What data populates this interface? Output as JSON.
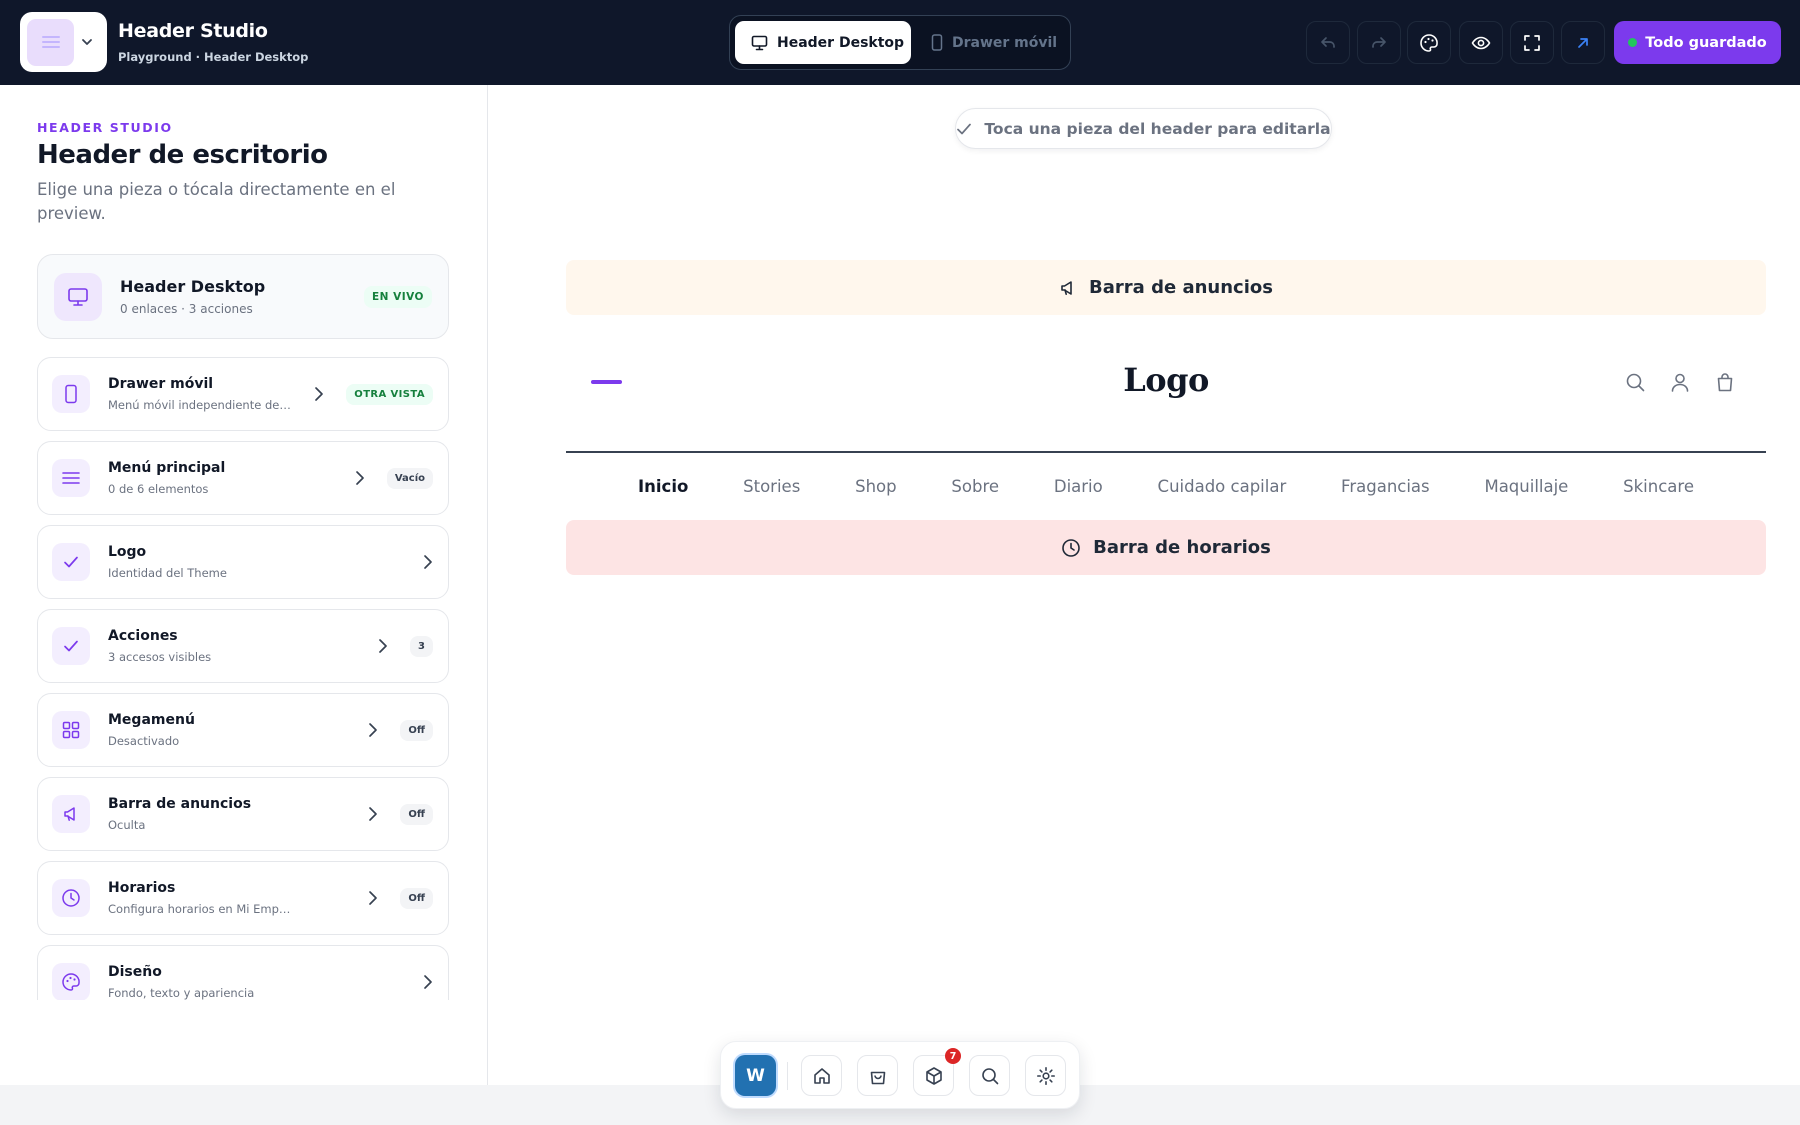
{
  "app": {
    "title": "Header Studio",
    "subtitle": "Playground · Header Desktop"
  },
  "view_toggle": {
    "desktop_label": "Header Desktop",
    "mobile_label": "Drawer móvil"
  },
  "toolbar": {
    "save_label": "Todo guardado"
  },
  "sidebar": {
    "eyebrow": "HEADER STUDIO",
    "title": "Header de escritorio",
    "description": "Elige una pieza o tócala directamente en el preview.",
    "hero": {
      "title": "Header Desktop",
      "subtitle": "0 enlaces · 3 acciones",
      "badge": "EN VIVO"
    },
    "items": [
      {
        "title": "Drawer móvil",
        "subtitle": "Menú móvil independiente del header de escritorio",
        "badge": "OTRA VISTA",
        "icon": "smartphone-icon"
      },
      {
        "title": "Menú principal",
        "subtitle": "0 de 6 elementos",
        "badge": "Vacío",
        "icon": "menu-icon"
      },
      {
        "title": "Logo",
        "subtitle": "Identidad del Theme",
        "badge": "",
        "icon": "check-icon"
      },
      {
        "title": "Acciones",
        "subtitle": "3 accesos visibles",
        "badge": "3",
        "icon": "check-icon"
      },
      {
        "title": "Megamenú",
        "subtitle": "Desactivado",
        "badge": "Off",
        "icon": "grid-icon"
      },
      {
        "title": "Barra de anuncios",
        "subtitle": "Oculta",
        "badge": "Off",
        "icon": "megaphone-icon"
      },
      {
        "title": "Horarios",
        "subtitle": "Configura horarios en Mi Empresa",
        "badge": "Off",
        "icon": "clock-icon"
      },
      {
        "title": "Diseño",
        "subtitle": "Fondo, texto y apariencia",
        "badge": "",
        "icon": "palette-icon"
      }
    ]
  },
  "preview": {
    "hint": "Toca una pieza del header para editarla",
    "announcement_bar": "Barra de anuncios",
    "logo": "Logo",
    "nav": [
      "Inicio",
      "Stories",
      "Shop",
      "Sobre",
      "Diario",
      "Cuidado capilar",
      "Fragancias",
      "Maquillaje",
      "Skincare"
    ],
    "hours_bar": "Barra de horarios"
  },
  "dock": {
    "wp_label": "W",
    "notification_count": "7"
  },
  "colors": {
    "accent": "#7c3aed",
    "topbar": "#0f172a",
    "announcement_bg": "#fff7ed",
    "hours_bg": "#fde4e4",
    "live_green": "#15803d",
    "wp_blue": "#2271b1",
    "notification_red": "#dc2626"
  }
}
